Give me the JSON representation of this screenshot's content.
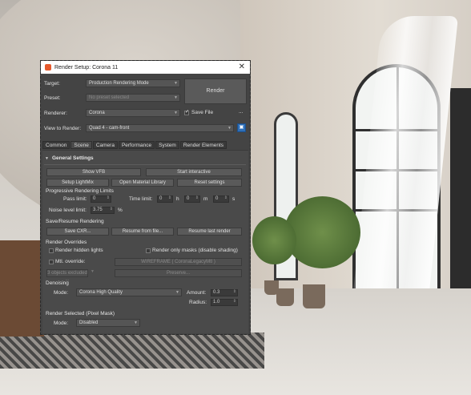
{
  "window": {
    "title": "Render Setup: Corona 11",
    "close_icon": "close-icon"
  },
  "header": {
    "target_label": "Target:",
    "target_value": "Production Rendering Mode",
    "preset_label": "Preset:",
    "preset_value": "No preset selected",
    "renderer_label": "Renderer:",
    "renderer_value": "Corona",
    "save_file_label": "Save File",
    "render_button": "Render",
    "view_label": "View to Render:",
    "view_value": "Quad 4 - cam-front",
    "more_dots": "..."
  },
  "tabs": [
    "Common",
    "Scene",
    "Camera",
    "Performance",
    "System",
    "Render Elements"
  ],
  "active_tab": "Scene",
  "general": {
    "title": "General Settings",
    "show_vfb": "Show VFB",
    "start_interactive": "Start interactive",
    "setup_lightmix": "Setup LightMix",
    "open_material_library": "Open Material Library",
    "reset_settings": "Reset settings"
  },
  "progressive": {
    "title": "Progressive Rendering Limits",
    "pass_limit_label": "Pass limit:",
    "pass_limit": "0",
    "time_limit_label": "Time limit:",
    "time_h": "0",
    "h": "h",
    "time_m": "0",
    "m": "m",
    "time_s": "0",
    "s": "s",
    "noise_label": "Noise level limit:",
    "noise_value": "3.75",
    "percent": "%"
  },
  "save_resume": {
    "title": "Save/Resume Rendering",
    "save_cxr": "Save CXR...",
    "resume_from_file": "Resume from file...",
    "resume_last_render": "Resume last render"
  },
  "overrides": {
    "title": "Render Overrides",
    "render_hidden_lights": "Render hidden lights",
    "render_only_masks": "Render only masks (disable shading)",
    "mtl_override": "Mtl. override:",
    "mtl_value": "WIREFRAME ( CoronaLegacyMtl )",
    "objects_excluded": "3 objects excluded ...",
    "preserve": "Preserve..."
  },
  "denoising": {
    "title": "Denoising",
    "mode_label": "Mode:",
    "mode_value": "Corona High Quality",
    "amount_label": "Amount:",
    "amount_value": "0.3",
    "radius_label": "Radius:",
    "radius_value": "1.0"
  },
  "render_selected": {
    "title": "Render Selected (Pixel Mask)",
    "mode_label": "Mode:",
    "mode_value": "Disabled"
  },
  "colors": {
    "panel": "#4a4a4a",
    "titlebar": "#ffffff",
    "accent": "#2e6fb8"
  }
}
